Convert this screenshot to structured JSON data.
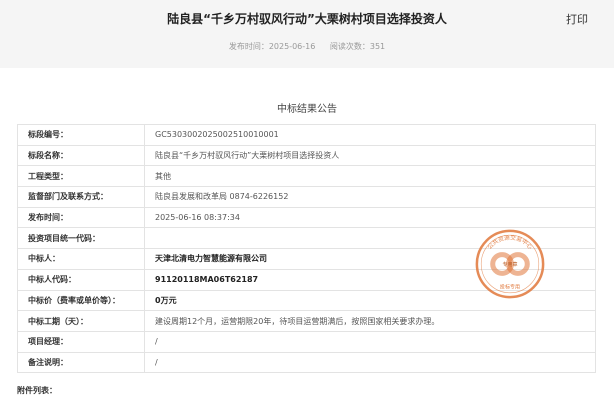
{
  "header": {
    "title": "陆良县“千乡万村驭风行动”大栗树村项目选择投资人",
    "print_label": "打印",
    "publish_label": "发布时间：",
    "publish_date": "2025-06-16",
    "views_label": "阅读次数：",
    "views_count": "351"
  },
  "notice": {
    "subtitle": "中标结果公告"
  },
  "rows": [
    {
      "label": "标段编号：",
      "value": "GC5303002025002510010001"
    },
    {
      "label": "标段名称：",
      "value": "陆良县“千乡万村驭风行动”大栗树村项目选择投资人"
    },
    {
      "label": "工程类型：",
      "value": "其他"
    },
    {
      "label": "监督部门及联系方式：",
      "value": "陆良县发展和改革局 0874-6226152"
    },
    {
      "label": "发布时间：",
      "value": "2025-06-16 08:37:34"
    },
    {
      "label": "投资项目统一代码：",
      "value": ""
    },
    {
      "label": "中标人：",
      "value": "天津北清电力智慧能源有限公司"
    },
    {
      "label": "中标人代码：",
      "value": "91120118MA06T62187"
    },
    {
      "label": "中标价（费率或单价等）：",
      "value": "0万元"
    },
    {
      "label": "中标工期（天）：",
      "value": "建设周期12个月，运营期限20年，待项目运营期满后，按照国家相关要求办理。"
    },
    {
      "label": "项目经理：",
      "value": "/"
    },
    {
      "label": "备注说明：",
      "value": "/"
    }
  ],
  "attachments_label": "附件列表：",
  "seal": {
    "text": "公共资源交易中心",
    "center": "专用章",
    "bottom": "投标专用",
    "color": "#e0773a"
  }
}
